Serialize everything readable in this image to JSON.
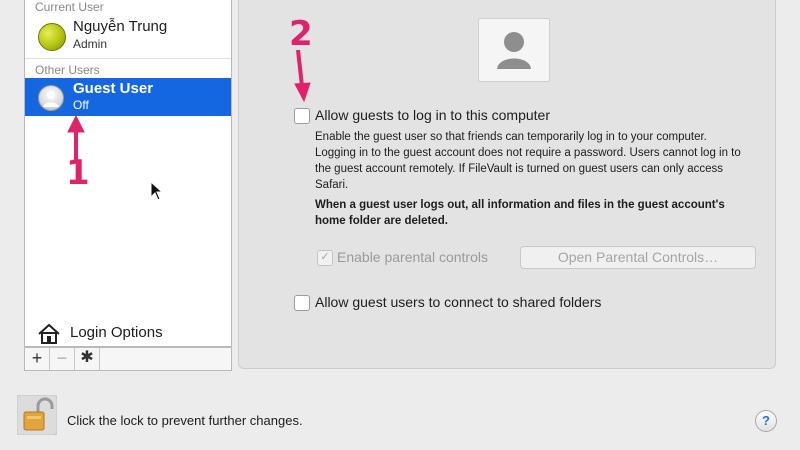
{
  "sidebar": {
    "current_user_header": "Current User",
    "current_user": {
      "name": "Nguyễn Trung",
      "role": "Admin"
    },
    "other_users_header": "Other Users",
    "guest_user": {
      "name": "Guest User",
      "status": "Off",
      "selected": true
    },
    "login_options": "Login Options",
    "buttons": {
      "add": "+",
      "remove": "−",
      "settings_icon": "gear-icon"
    }
  },
  "main": {
    "allow_guest_login": {
      "label": "Allow guests to log in to this computer",
      "checked": false
    },
    "description": "Enable the guest user so that friends can temporarily log in to your computer. Logging in to the guest account does not require a password. Users cannot log in to the guest account remotely. If FileVault is turned on guest users can only access Safari.",
    "warning": "When a guest user logs out, all information and files in the guest account's home folder are deleted.",
    "parental_controls": {
      "label": "Enable parental controls",
      "checked": true,
      "enabled": false
    },
    "open_parental_button": "Open Parental Controls…",
    "shared_folders": {
      "label": "Allow guest users to connect to shared folders",
      "checked": false
    }
  },
  "footer": {
    "lock_text": "Click the lock to prevent further changes.",
    "help_label": "?"
  },
  "annotations": {
    "step1": "1",
    "step2": "2",
    "color": "#e0226a"
  },
  "colors": {
    "selection": "#1467e0",
    "panel": "#e3e3e3",
    "window": "#ececec"
  }
}
